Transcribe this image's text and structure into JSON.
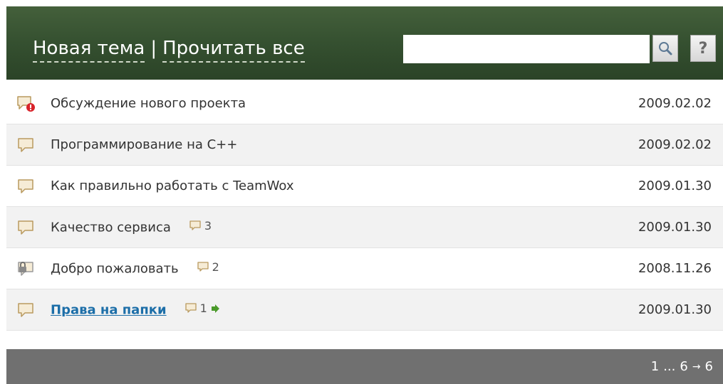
{
  "header": {
    "new_topic_label": "Новая тема",
    "separator": "|",
    "read_all_label": "Прочитать все",
    "search": {
      "value": "",
      "placeholder": ""
    },
    "help_label": "?"
  },
  "colors": {
    "header_bg": "#355030",
    "link": "#1c6ea8",
    "footer_bg": "#707070",
    "alert_red": "#d8232a",
    "next_arrow": "#4a9a2a"
  },
  "topics": [
    {
      "title": "Обсуждение нового проекта",
      "date": "2009.02.02",
      "icon": "comment-alert-icon",
      "replies": ""
    },
    {
      "title": "Программирование на С++",
      "date": "2009.02.02",
      "icon": "comment-icon",
      "replies": ""
    },
    {
      "title": "Как правильно работать с TeamWox",
      "date": "2009.01.30",
      "icon": "comment-icon",
      "replies": ""
    },
    {
      "title": "Качество сервиса",
      "date": "2009.01.30",
      "icon": "comment-icon",
      "replies": "3"
    },
    {
      "title": "Добро пожаловать",
      "date": "2008.11.26",
      "icon": "comment-locked-icon",
      "replies": "2"
    },
    {
      "title": "Права на папки",
      "date": "2009.01.30",
      "icon": "comment-icon",
      "replies": "1"
    }
  ],
  "pagination": {
    "first": "1",
    "ellipsis": "...",
    "current": "6",
    "arrow": "→",
    "last": "6"
  }
}
